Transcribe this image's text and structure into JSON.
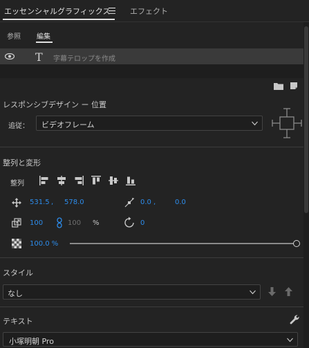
{
  "header": {
    "panel_title": "エッセンシャルグラフィックス",
    "menu_icon": "hamburger-icon",
    "effects_tab": "エフェクト"
  },
  "subtabs": {
    "browse": "参照",
    "edit": "編集"
  },
  "layer": {
    "name": "字幕テロップを作成",
    "visibility_icon": "eye-icon",
    "type_icon": "text-T-icon"
  },
  "responsive": {
    "title": "レスポンシブデザイン ー 位置",
    "follow_label": "追従：",
    "follow_value": "ビデオフレーム"
  },
  "align_transform": {
    "title": "整列と変形",
    "align_label": "整列",
    "position_x": "531.5",
    "position_sep": ",",
    "position_y": "578.0",
    "anchor_x": "0.0",
    "anchor_sep": ",",
    "anchor_y": "0.0",
    "scale": "100",
    "scale_width": "100",
    "scale_unit": "%",
    "rotation": "0",
    "opacity": "100.0 %",
    "opacity_fraction": 1.0
  },
  "style": {
    "title": "スタイル",
    "value": "なし"
  },
  "text": {
    "title": "テキスト",
    "font": "小塚明朝 Pro"
  },
  "colors": {
    "accent": "#2d8ceb",
    "bg": "#232323"
  }
}
